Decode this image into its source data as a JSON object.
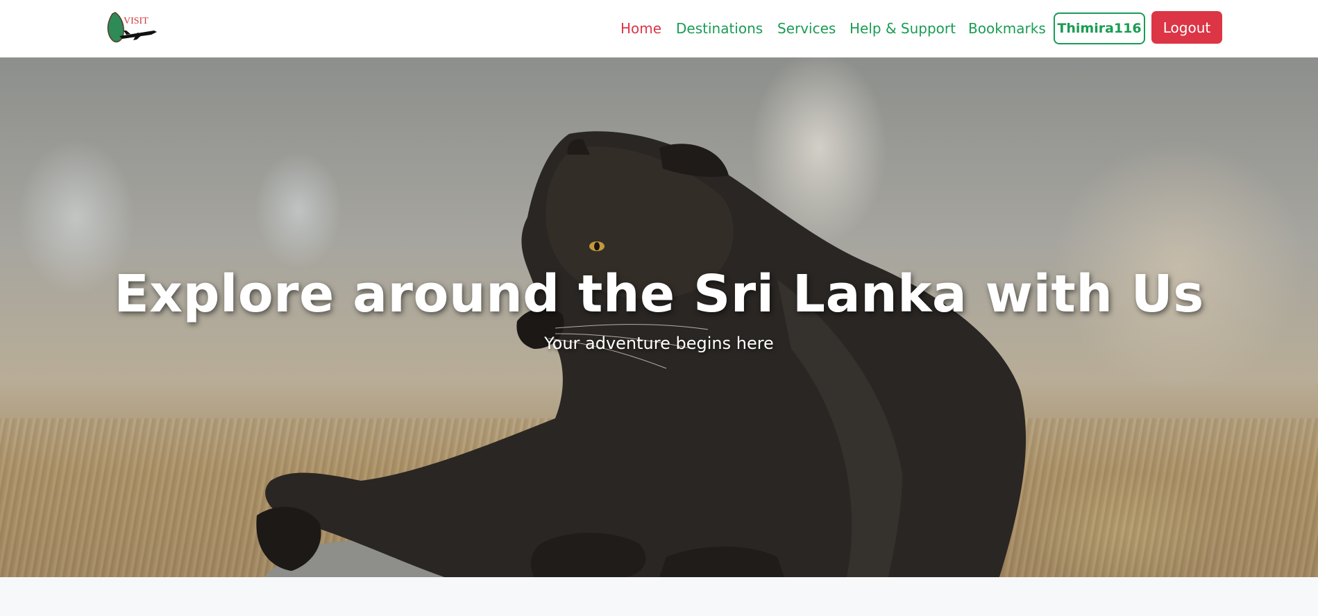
{
  "brand": {
    "logo_text": "VISIT"
  },
  "nav": {
    "home": "Home",
    "destinations": "Destinations",
    "services": "Services",
    "help": "Help & Support",
    "bookmarks": "Bookmarks",
    "user": "Thimira116",
    "logout": "Logout"
  },
  "hero": {
    "title": "Explore around the Sri Lanka with Us",
    "subtitle": "Your adventure begins here"
  },
  "colors": {
    "primary_green": "#1a9c54",
    "active_red": "#dc3545",
    "logout_bg": "#dc3545"
  }
}
